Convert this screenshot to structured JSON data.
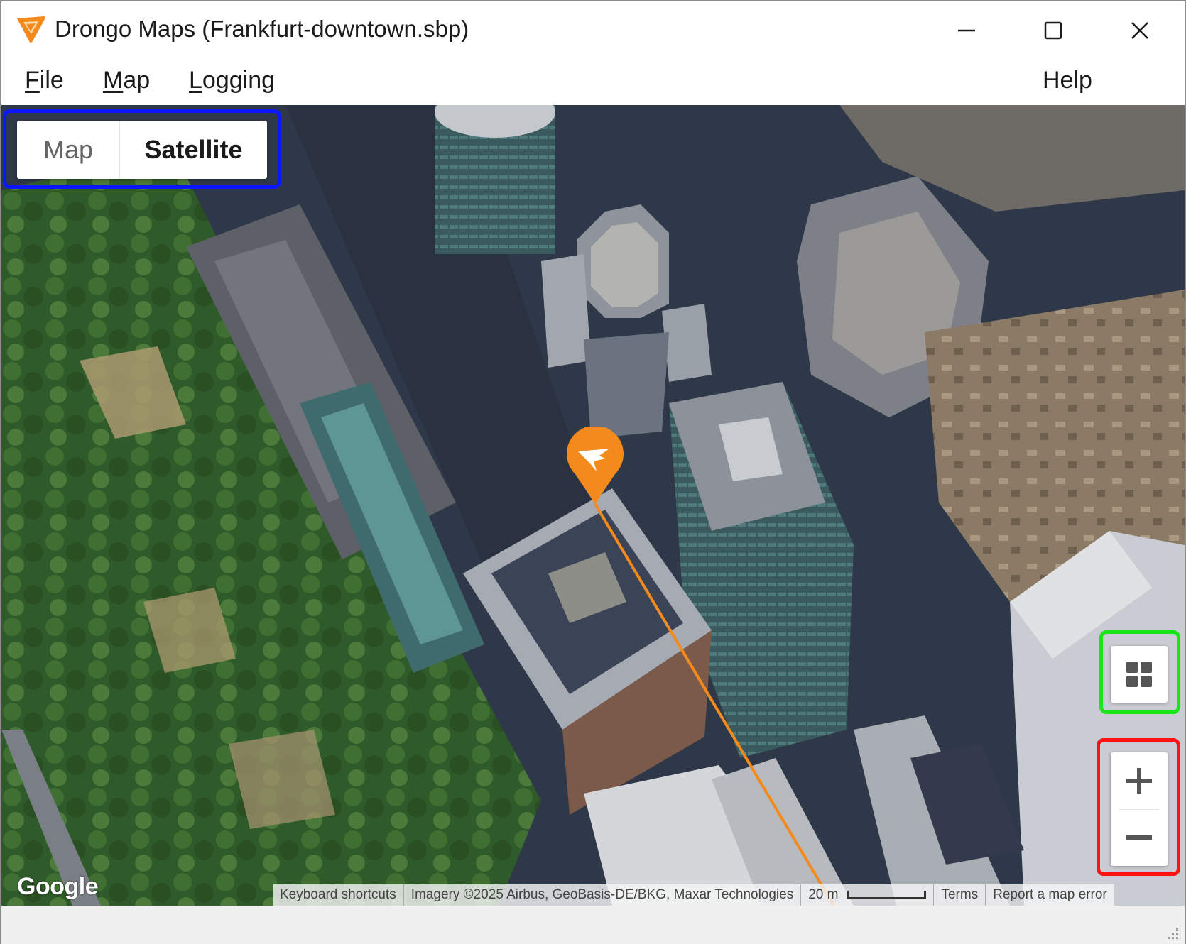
{
  "window": {
    "title": "Drongo Maps (Frankfurt-downtown.sbp)",
    "controls": {
      "minimize_icon": "minimize-icon",
      "maximize_icon": "maximize-icon",
      "close_icon": "close-icon"
    }
  },
  "menu": {
    "file": {
      "mnemonic": "F",
      "rest": "ile"
    },
    "map": {
      "mnemonic": "M",
      "rest": "ap"
    },
    "logging": {
      "mnemonic": "L",
      "rest": "ogging"
    },
    "help": "Help"
  },
  "map": {
    "type_control": {
      "map_label": "Map",
      "satellite_label": "Satellite",
      "selected": "Satellite"
    },
    "layers_icon": "grid-icon",
    "zoom": {
      "in_icon": "plus-icon",
      "out_icon": "minus-icon"
    },
    "marker_icon": "drongo-bird-icon",
    "google_logo": "Google",
    "attribution": {
      "keyboard_shortcuts": "Keyboard shortcuts",
      "imagery": "Imagery ©2025 Airbus, GeoBasis-DE/BKG, Maxar Technologies",
      "scale": "20 m",
      "terms": "Terms",
      "report": "Report a map error"
    }
  },
  "colors": {
    "accent": "#f28a1e",
    "highlight_map_type": "#0a18ff",
    "highlight_layers": "#19e619",
    "highlight_zoom": "#ff1212"
  }
}
